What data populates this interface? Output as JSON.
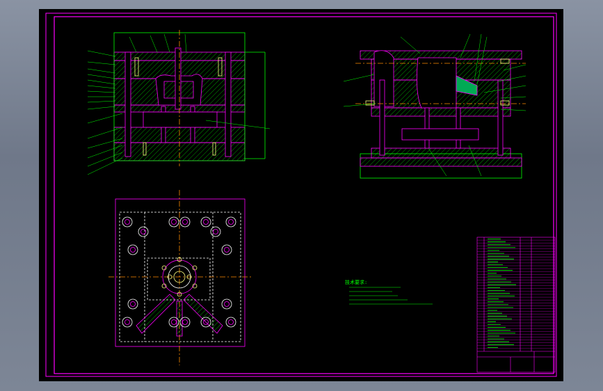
{
  "colors": {
    "background": "#000000",
    "frame": "#ff00ff",
    "part_outline": "#ff00ff",
    "hatch": "#00ff00",
    "center_line": "#ff8c00",
    "leader": "#00ff00",
    "bolt": "#ffff80",
    "annotation_text": "#00ff00"
  },
  "icons": {
    "bolt_symbol": "bolt-head-icon",
    "guide_pillar_symbol": "guide-pillar-icon",
    "screw_hole_symbol": "screw-hole-icon"
  },
  "drawing": {
    "views": [
      "front-section-view",
      "side-section-view",
      "top-plan-view"
    ],
    "technical_requirements": {
      "heading": "技术要求:",
      "items": [
        "",
        "",
        "",
        "",
        ""
      ]
    },
    "title_block": {
      "parts_list_rows": 40
    }
  }
}
